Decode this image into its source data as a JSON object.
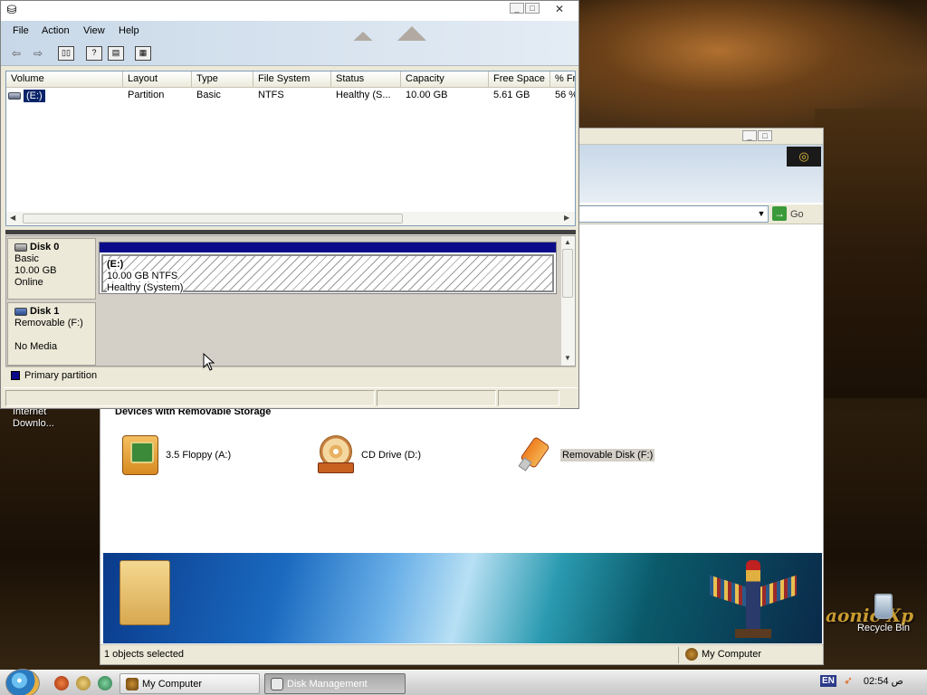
{
  "desktop": {
    "icon_label": "Internet Downlo...",
    "recycle_bin": "Recycle Bin",
    "logo_text": "aonic Xp"
  },
  "disk_management": {
    "title": "Disk Management",
    "menu": [
      "File",
      "Action",
      "View",
      "Help"
    ],
    "toolbar_icons": [
      "back-icon",
      "forward-icon",
      "console-tree-icon",
      "help-icon",
      "properties-icon",
      "refresh-icon"
    ],
    "columns": [
      "Volume",
      "Layout",
      "Type",
      "File System",
      "Status",
      "Capacity",
      "Free Space",
      "% Fr"
    ],
    "volumes": [
      {
        "volume": "(E:)",
        "layout": "Partition",
        "type": "Basic",
        "file_system": "NTFS",
        "status": "Healthy (S...",
        "capacity": "10.00 GB",
        "free_space": "5.61 GB",
        "percent_free": "56 %"
      }
    ],
    "disks": [
      {
        "name": "Disk 0",
        "type": "Basic",
        "size": "10.00 GB",
        "state": "Online",
        "partition": {
          "label": "(E:)",
          "size_fs": "10.00 GB NTFS",
          "status": "Healthy (System)"
        }
      },
      {
        "name": "Disk 1",
        "type": "Removable (F:)",
        "state": "No Media"
      }
    ],
    "legend": "Primary partition",
    "colors": {
      "primary_partition": "#0a0a8a",
      "selection": "#0a246a"
    }
  },
  "my_computer": {
    "title": "My Computer",
    "go_label": "Go",
    "section_title": "Devices with Removable Storage",
    "devices": [
      {
        "label": "3.5 Floppy (A:)",
        "icon": "floppy-drive-icon"
      },
      {
        "label": "CD Drive (D:)",
        "icon": "cd-drive-icon"
      },
      {
        "label": "Removable Disk (F:)",
        "icon": "usb-drive-icon"
      }
    ],
    "status_left": "1 objects selected",
    "status_right": "My Computer"
  },
  "taskbar": {
    "buttons": [
      {
        "label": "My Computer"
      },
      {
        "label": "Disk Management"
      }
    ],
    "lang": "EN",
    "clock": "02:54 ص"
  }
}
